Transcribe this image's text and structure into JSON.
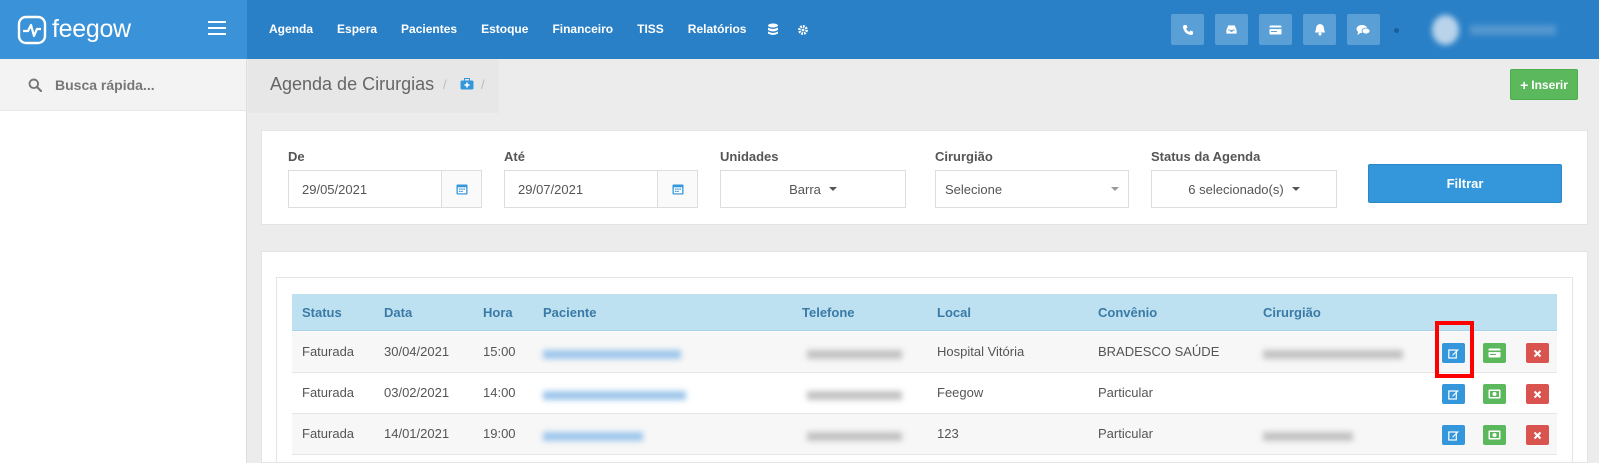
{
  "app": {
    "brand": "feegow"
  },
  "nav": {
    "items": [
      {
        "label": "Agenda"
      },
      {
        "label": "Espera"
      },
      {
        "label": "Pacientes"
      },
      {
        "label": "Estoque"
      },
      {
        "label": "Financeiro"
      },
      {
        "label": "TISS"
      },
      {
        "label": "Relatórios"
      }
    ],
    "icons": [
      "database-icon",
      "gear-icon"
    ]
  },
  "toolbar": {
    "icons": [
      "phone-icon",
      "inbox-icon",
      "card-icon",
      "bell-icon",
      "chat-icon"
    ]
  },
  "sidebar": {
    "search_placeholder": "Busca rápida..."
  },
  "header": {
    "title": "Agenda de Cirurgias",
    "breadcrumb_icon": "medkit-icon",
    "insert_label": "Inserir"
  },
  "filters": {
    "from": {
      "label": "De",
      "value": "29/05/2021"
    },
    "to": {
      "label": "Até",
      "value": "29/07/2021"
    },
    "units": {
      "label": "Unidades",
      "value": "Barra"
    },
    "surgeon": {
      "label": "Cirurgião",
      "value": "Selecione"
    },
    "status": {
      "label": "Status da Agenda",
      "value": "6 selecionado(s)"
    },
    "submit_label": "Filtrar"
  },
  "table": {
    "columns": [
      "Status",
      "Data",
      "Hora",
      "Paciente",
      "Telefone",
      "Local",
      "Convênio",
      "Cirurgião"
    ],
    "rows": [
      {
        "status": "Faturada",
        "date": "30/04/2021",
        "time": "15:00",
        "local": "Hospital Vitória",
        "insurance": "BRADESCO SAÚDE",
        "pay_icon": "card-icon"
      },
      {
        "status": "Faturada",
        "date": "03/02/2021",
        "time": "14:00",
        "local": "Feegow",
        "insurance": "Particular",
        "pay_icon": "cash-icon"
      },
      {
        "status": "Faturada",
        "date": "14/01/2021",
        "time": "19:00",
        "local": "123",
        "insurance": "Particular",
        "pay_icon": "cash-icon"
      }
    ]
  },
  "colors": {
    "topbar": "#2a80c7",
    "brand_bg": "#3a93d8",
    "primary": "#3497db",
    "success": "#5cb85c",
    "danger": "#d9534f",
    "table_header": "#bde1f0",
    "highlight": "#ff0000"
  }
}
